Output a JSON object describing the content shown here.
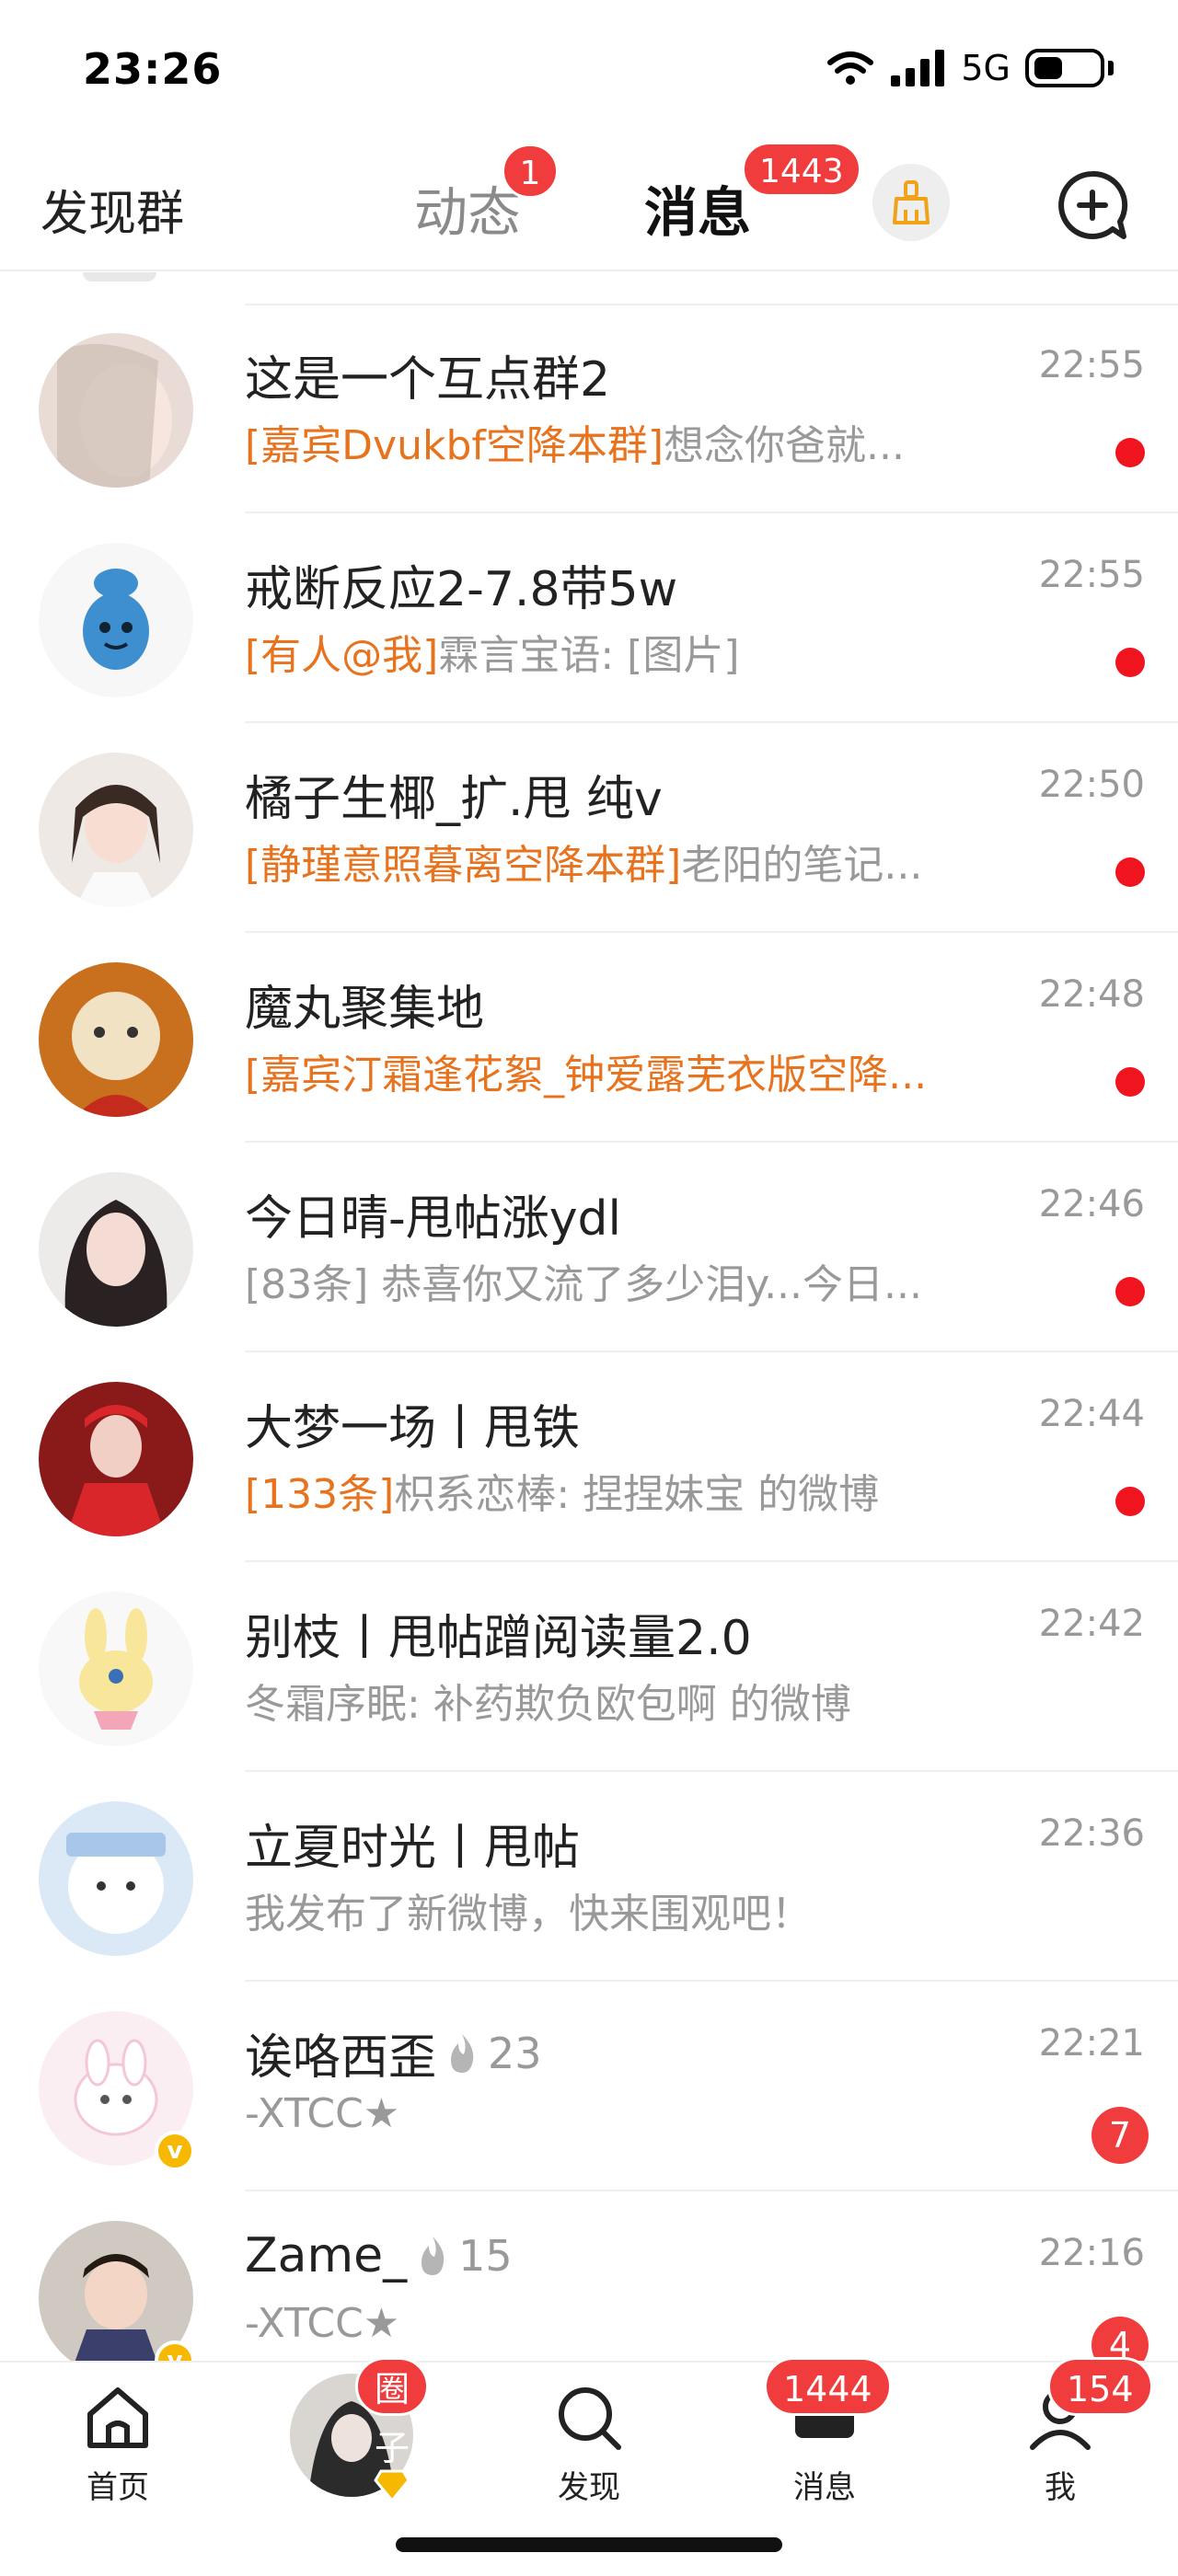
{
  "status_bar": {
    "time": "23:26",
    "network": "5G"
  },
  "header": {
    "discover_group": "发现群",
    "tab_feed": "动态",
    "tab_feed_badge": "1",
    "tab_messages": "消息",
    "tab_messages_badge": "1443"
  },
  "conversations": [
    {
      "title": "这是一个互点群2",
      "tag": "[嘉宾Dvukbf空降本群]",
      "preview": "想念你爸就...",
      "time": "22:55",
      "indicator": "dot"
    },
    {
      "title": "戒断反应2-7.8带5w",
      "tag": "[有人@我]",
      "preview": "霖言宝语: [图片]",
      "time": "22:55",
      "indicator": "dot"
    },
    {
      "title": "橘子生椰_扩.甩 纯v",
      "tag": "[静瑾意照暮离空降本群]",
      "preview": "老阳的笔记...",
      "time": "22:50",
      "indicator": "dot"
    },
    {
      "title": "魔丸聚集地",
      "tag": "[嘉宾汀霜逢花絮_钟爱露芜衣版空降...",
      "preview": "",
      "time": "22:48",
      "indicator": "dot"
    },
    {
      "title": "今日晴-甩帖涨ydl",
      "tag": "",
      "preview": "[83条] 恭喜你又流了多少泪y...今日...",
      "time": "22:46",
      "indicator": "dot"
    },
    {
      "title": "大梦一场丨甩铁",
      "tag": "[133条]",
      "preview": "枳系恋棒: 捏捏妹宝 的微博",
      "time": "22:44",
      "indicator": "dot"
    },
    {
      "title": "别枝丨甩帖蹭阅读量2.0",
      "tag": "",
      "preview": "冬霜序眠: 补药欺负欧包啊 的微博",
      "time": "22:42",
      "indicator": "none"
    },
    {
      "title": "立夏时光丨甩帖",
      "tag": "",
      "preview": "我发布了新微博，快来围观吧！",
      "time": "22:36",
      "indicator": "none"
    },
    {
      "title": "诶咯西歪",
      "fire": "23",
      "tag": "",
      "preview": "-XTCC★",
      "time": "22:21",
      "indicator": "count",
      "count": "7",
      "verified": true
    },
    {
      "title": "Zame_",
      "fire": "15",
      "tag": "",
      "preview": "-XTCC★",
      "time": "22:16",
      "indicator": "count",
      "count": "4",
      "verified": true
    }
  ],
  "bottom_nav": {
    "home": "首页",
    "circle_badge": "圈子",
    "discover": "发现",
    "messages": "消息",
    "messages_badge": "1444",
    "me": "我",
    "me_badge": "154"
  },
  "colors": {
    "accent_orange": "#e8731f",
    "badge_red": "#f03c3c",
    "tab_underline": "#ffb400"
  }
}
